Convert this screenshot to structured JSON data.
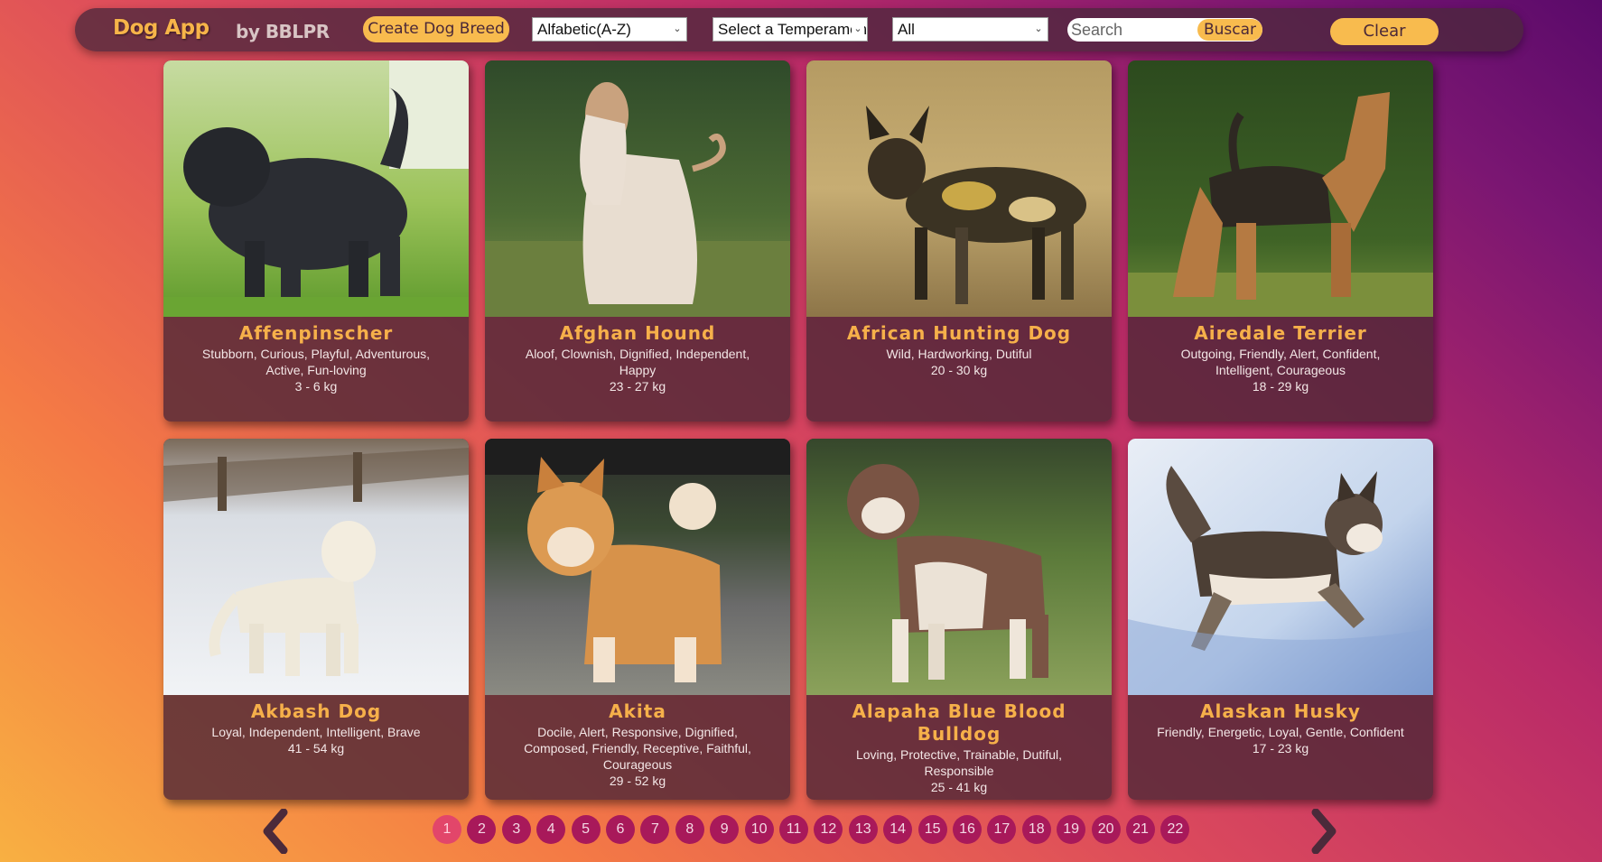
{
  "navbar": {
    "logo": "Dog App",
    "byline": "by BBLPR",
    "create_label": "Create Dog Breed",
    "order_select": "Alfabetic(A-Z)",
    "temperament_select": "Select a Temperament",
    "source_select": "All",
    "search_placeholder": "Search",
    "search_button": "Buscar",
    "clear_button": "Clear"
  },
  "dogs": [
    {
      "name": "Affenpinscher",
      "temperament": "Stubborn, Curious, Playful, Adventurous, Active, Fun-loving",
      "weight": "3 - 6 kg"
    },
    {
      "name": "Afghan Hound",
      "temperament": "Aloof, Clownish, Dignified, Independent, Happy",
      "weight": "23 - 27 kg"
    },
    {
      "name": "African Hunting Dog",
      "temperament": "Wild, Hardworking, Dutiful",
      "weight": "20 - 30 kg"
    },
    {
      "name": "Airedale Terrier",
      "temperament": "Outgoing, Friendly, Alert, Confident, Intelligent, Courageous",
      "weight": "18 - 29 kg"
    },
    {
      "name": "Akbash Dog",
      "temperament": "Loyal, Independent, Intelligent, Brave",
      "weight": "41 - 54 kg"
    },
    {
      "name": "Akita",
      "temperament": "Docile, Alert, Responsive, Dignified, Composed, Friendly, Receptive, Faithful, Courageous",
      "weight": "29 - 52 kg"
    },
    {
      "name": "Alapaha Blue Blood Bulldog",
      "temperament": "Loving, Protective, Trainable, Dutiful, Responsible",
      "weight": "25 - 41 kg"
    },
    {
      "name": "Alaskan Husky",
      "temperament": "Friendly, Energetic, Loyal, Gentle, Confident",
      "weight": "17 - 23 kg"
    }
  ],
  "pagination": {
    "current": "1",
    "pages": [
      "1",
      "2",
      "3",
      "4",
      "5",
      "6",
      "7",
      "8",
      "9",
      "10",
      "11",
      "12",
      "13",
      "14",
      "15",
      "16",
      "17",
      "18",
      "19",
      "20",
      "21",
      "22"
    ]
  },
  "icons": {
    "prev": "chevron-left-icon",
    "next": "chevron-right-icon"
  },
  "colors": {
    "accent": "#f8bb4e",
    "title": "#f6b04a",
    "page": "#a8195a",
    "page_active": "#e2466a"
  }
}
